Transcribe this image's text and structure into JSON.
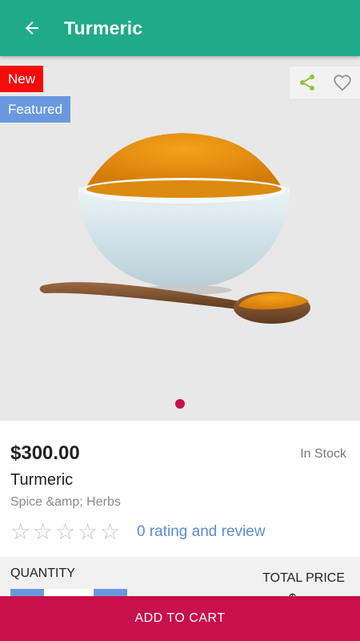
{
  "toolbar": {
    "title": "Turmeric",
    "back_icon": "arrow-left-icon"
  },
  "hero": {
    "badges": {
      "new": "New",
      "featured": "Featured"
    },
    "actions": {
      "share_icon": "share-icon",
      "favorite_icon": "heart-outline-icon"
    },
    "pager_count": 1,
    "pager_active": 0
  },
  "product": {
    "price": "$300.00",
    "stock": "In Stock",
    "name": "Turmeric",
    "category": "Spice &amp; Herbs",
    "rating": {
      "stars": 0,
      "max": 5,
      "star_char": "☆",
      "link": "0 rating and review"
    }
  },
  "quantity": {
    "label": "QUANTITY",
    "total_label": "TOTAL PRICE",
    "total_value": "$"
  },
  "cart": {
    "label": "ADD TO CART"
  },
  "colors": {
    "toolbar": "#1faa88",
    "badge_new": "#f40c0c",
    "badge_featured": "#6a98df",
    "accent": "#c8104b",
    "link": "#5b8cd6",
    "share": "#8cc63f"
  }
}
